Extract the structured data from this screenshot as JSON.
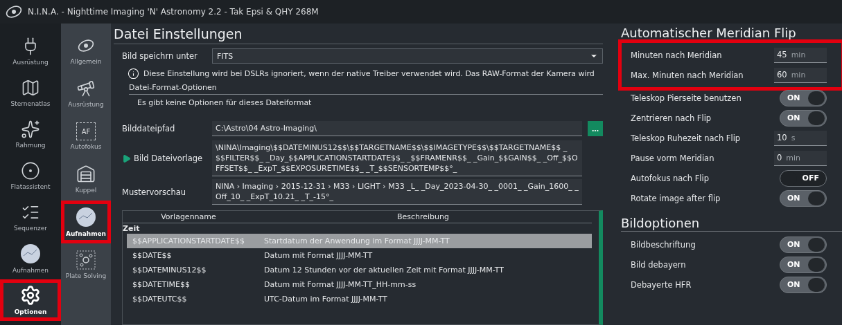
{
  "window": {
    "title": "N.I.N.A. - Nighttime Imaging 'N' Astronomy 2.2  -  Tak Epsi & QHY 268M"
  },
  "nav": [
    {
      "label": "Ausrüstung",
      "kind": "plug",
      "selected": false,
      "highlighted": false
    },
    {
      "label": "Sternenatlas",
      "kind": "map",
      "selected": false,
      "highlighted": false
    },
    {
      "label": "Rahmung",
      "kind": "stars",
      "selected": false,
      "highlighted": false
    },
    {
      "label": "Flatassistent",
      "kind": "flat",
      "selected": false,
      "highlighted": false
    },
    {
      "label": "Sequenzer",
      "kind": "list",
      "selected": false,
      "highlighted": false
    },
    {
      "label": "Aufnahmen",
      "kind": "sky",
      "selected": false,
      "highlighted": false
    },
    {
      "label": "Optionen",
      "kind": "gears",
      "selected": true,
      "highlighted": true
    }
  ],
  "subnav": [
    {
      "label": "Allgemein",
      "kind": "galaxy",
      "selected": false,
      "highlighted": false
    },
    {
      "label": "Ausrüstung",
      "kind": "telescope",
      "selected": false,
      "highlighted": false
    },
    {
      "label": "Autofokus",
      "kind": "af",
      "icon_text": "AF",
      "selected": false,
      "highlighted": false
    },
    {
      "label": "Kuppel",
      "kind": "dome",
      "selected": false,
      "highlighted": false
    },
    {
      "label": "Aufnahmen",
      "kind": "sky",
      "selected": true,
      "highlighted": true
    },
    {
      "label": "Plate Solving",
      "kind": "solve",
      "selected": false,
      "highlighted": false
    }
  ],
  "file_settings": {
    "title": "Datei Einstellungen",
    "save_as": {
      "label": "Bild speichrn unter",
      "value": "FITS"
    },
    "notice": "Diese Einstellung wird bei DSLRs ignoriert, wenn der native Treiber verwendet wird. Das RAW-Format der Kamera wird",
    "format_options": {
      "title": "Datei-Format-Optionen",
      "text": "Es gibt keine Optionen für dieses Dateiformat"
    },
    "path": {
      "label": "Bilddateipfad",
      "value": "C:\\Astro\\04 Astro-Imaging\\",
      "button": "..."
    },
    "template": {
      "label": "Bild Dateivorlage",
      "value": "\\NINA\\Imaging\\$$DATEMINUS12$$\\$$TARGETNAME$$\\$$IMAGETYPE$$\\$$TARGETNAME$$ _$$FILTER$$_ _Day_$$APPLICATIONSTARTDATE$$_ _$$FRAMENR$$_ _Gain_$$GAIN$$_ _Off_$$OFFSET$$_ _ExpT_$$EXPOSURETIME$$_ _T_$$SENSORTEMP$$°_"
    },
    "preview": {
      "label": "Mustervorschau",
      "value": "NINA › Imaging › 2015-12-31 › M33 › LIGHT › M33 _L_ _Day_2023-04-30_ _0001_ _Gain_1600_ _Off_10_ _ExpT_10.21_ _T_-15°_"
    },
    "table": {
      "columns": [
        "Vorlagenname",
        "Beschreibung"
      ],
      "group": "Zeit",
      "rows": [
        {
          "name": "$$APPLICATIONSTARTDATE$$",
          "description": "Startdatum der Anwendung im Format JJJJ-MM-TT",
          "selected": true
        },
        {
          "name": "$$DATE$$",
          "description": "Datum mit Format JJJJ-MM-TT",
          "selected": false
        },
        {
          "name": "$$DATEMINUS12$$",
          "description": "Datum 12 Stunden vor der aktuellen Zeit mit Format JJJJ-MM-TT",
          "selected": false
        },
        {
          "name": "$$DATETIME$$",
          "description": "Datum mit Format JJJJ-MM-TT_HH-mm-ss",
          "selected": false
        },
        {
          "name": "$$DATEUTC$$",
          "description": "UTC-Datum im Format JJJJ-MM-TT",
          "selected": false
        }
      ]
    }
  },
  "meridian_flip": {
    "title": "Automatischer Meridian Flip",
    "highlighted_rows": [
      {
        "kind": "number",
        "label": "Minuten nach Meridian",
        "value": "45",
        "unit": "min"
      },
      {
        "kind": "number",
        "label": "Max. Minuten nach Meridian",
        "value": "60",
        "unit": "min"
      }
    ],
    "rows": [
      {
        "kind": "toggle",
        "label": "Teleskop Pierseite benutzen",
        "on": true,
        "text": "ON"
      },
      {
        "kind": "toggle",
        "label": "Zentrieren nach Flip",
        "on": true,
        "text": "ON"
      },
      {
        "kind": "number",
        "label": "Teleskop Ruhezeit nach Flip",
        "value": "10",
        "unit": "s"
      },
      {
        "kind": "number",
        "label": "Pause vorm Meridian",
        "value": "0",
        "unit": "min"
      },
      {
        "kind": "toggle",
        "label": "Autofokus nach Flip",
        "on": false,
        "text": "OFF"
      },
      {
        "kind": "toggle",
        "label": "Rotate image after flip",
        "on": true,
        "text": "ON"
      }
    ]
  },
  "image_options": {
    "title": "Bildoptionen",
    "rows": [
      {
        "kind": "toggle",
        "label": "Bildbeschriftung",
        "on": true,
        "text": "ON"
      },
      {
        "kind": "toggle",
        "label": "Bild debayern",
        "on": true,
        "text": "ON"
      },
      {
        "kind": "toggle",
        "label": "Debayerte HFR",
        "on": true,
        "text": "ON"
      }
    ]
  }
}
